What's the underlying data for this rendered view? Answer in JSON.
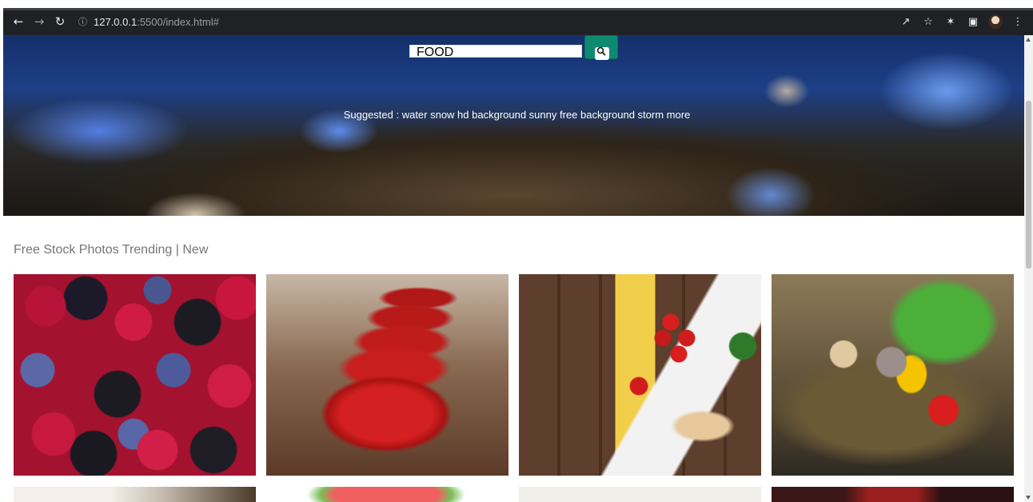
{
  "browser": {
    "url_host": "127.0.0.1",
    "url_rest": ":5500/index.html#",
    "icons": {
      "back": "arrow-left-icon",
      "forward": "arrow-right-icon",
      "reload": "reload-icon",
      "info": "info-icon",
      "share": "share-icon",
      "bookmark": "star-icon",
      "extensions": "puzzle-icon",
      "sidepanel": "sidepanel-icon",
      "menu": "kebab-menu-icon"
    }
  },
  "hero": {
    "search_value": "FOOD",
    "search_button_icon": "search-icon",
    "accent_color": "#0e8a72",
    "suggested_text": "Suggested : water snow hd background sunny free background storm more"
  },
  "gallery": {
    "title": "Free Stock Photos Trending | New",
    "images": [
      {
        "subject": "berries"
      },
      {
        "subject": "apples"
      },
      {
        "subject": "tomatoes and pasta"
      },
      {
        "subject": "vegetable basket"
      },
      {
        "subject": "bottle"
      },
      {
        "subject": "watermelon"
      },
      {
        "subject": "light food"
      },
      {
        "subject": "red interior"
      }
    ]
  }
}
